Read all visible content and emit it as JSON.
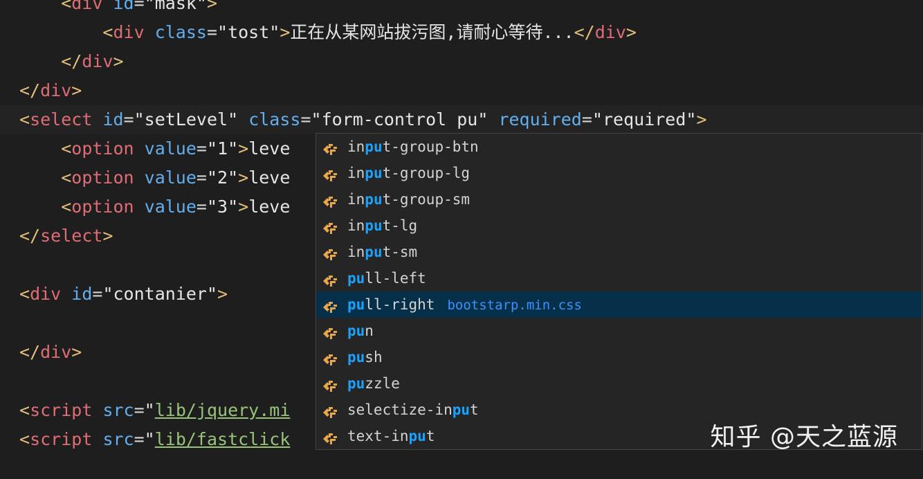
{
  "editor": {
    "lines": [
      {
        "indent": "    ",
        "parts": [
          [
            "ang",
            "<"
          ],
          [
            "tag",
            "div"
          ],
          [
            "plain",
            " "
          ],
          [
            "attr",
            "id"
          ],
          [
            "eq",
            "="
          ],
          [
            "str",
            "\"mask\""
          ],
          [
            "ang",
            ">"
          ]
        ]
      },
      {
        "indent": "        ",
        "parts": [
          [
            "ang",
            "<"
          ],
          [
            "tag",
            "div"
          ],
          [
            "plain",
            " "
          ],
          [
            "attr",
            "class"
          ],
          [
            "eq",
            "="
          ],
          [
            "str",
            "\"tost\""
          ],
          [
            "ang",
            ">"
          ],
          [
            "plain",
            "正在从某网站拔污图,请耐心等待..."
          ],
          [
            "ang",
            "</"
          ],
          [
            "tag",
            "div"
          ],
          [
            "ang",
            ">"
          ]
        ]
      },
      {
        "indent": "    ",
        "parts": [
          [
            "ang",
            "</"
          ],
          [
            "tag",
            "div"
          ],
          [
            "ang",
            ">"
          ]
        ]
      },
      {
        "indent": "",
        "parts": [
          [
            "ang",
            "</"
          ],
          [
            "tag",
            "div"
          ],
          [
            "ang",
            ">"
          ]
        ]
      },
      {
        "indent": "",
        "active": true,
        "parts": [
          [
            "ang",
            "<"
          ],
          [
            "tag",
            "select"
          ],
          [
            "plain",
            " "
          ],
          [
            "attr",
            "id"
          ],
          [
            "eq",
            "="
          ],
          [
            "str",
            "\"setLevel\""
          ],
          [
            "plain",
            " "
          ],
          [
            "attr",
            "class"
          ],
          [
            "eq",
            "="
          ],
          [
            "str",
            "\"form-control pu\""
          ],
          [
            "plain",
            " "
          ],
          [
            "attr",
            "required"
          ],
          [
            "eq",
            "="
          ],
          [
            "str",
            "\"required\""
          ],
          [
            "ang",
            ">"
          ]
        ]
      },
      {
        "indent": "    ",
        "parts": [
          [
            "ang",
            "<"
          ],
          [
            "tag",
            "option"
          ],
          [
            "plain",
            " "
          ],
          [
            "attr",
            "value"
          ],
          [
            "eq",
            "="
          ],
          [
            "str",
            "\"1\""
          ],
          [
            "ang",
            ">"
          ],
          [
            "plain",
            "leve"
          ]
        ]
      },
      {
        "indent": "    ",
        "parts": [
          [
            "ang",
            "<"
          ],
          [
            "tag",
            "option"
          ],
          [
            "plain",
            " "
          ],
          [
            "attr",
            "value"
          ],
          [
            "eq",
            "="
          ],
          [
            "str",
            "\"2\""
          ],
          [
            "ang",
            ">"
          ],
          [
            "plain",
            "leve"
          ]
        ]
      },
      {
        "indent": "    ",
        "parts": [
          [
            "ang",
            "<"
          ],
          [
            "tag",
            "option"
          ],
          [
            "plain",
            " "
          ],
          [
            "attr",
            "value"
          ],
          [
            "eq",
            "="
          ],
          [
            "str",
            "\"3\""
          ],
          [
            "ang",
            ">"
          ],
          [
            "plain",
            "leve"
          ]
        ]
      },
      {
        "indent": "",
        "parts": [
          [
            "ang",
            "</"
          ],
          [
            "tag",
            "select"
          ],
          [
            "ang",
            ">"
          ]
        ]
      },
      {
        "indent": "",
        "parts": []
      },
      {
        "indent": "",
        "parts": [
          [
            "ang",
            "<"
          ],
          [
            "tag",
            "div"
          ],
          [
            "plain",
            " "
          ],
          [
            "attr",
            "id"
          ],
          [
            "eq",
            "="
          ],
          [
            "str",
            "\"contanier\""
          ],
          [
            "ang",
            ">"
          ]
        ]
      },
      {
        "indent": "",
        "parts": []
      },
      {
        "indent": "",
        "parts": [
          [
            "ang",
            "</"
          ],
          [
            "tag",
            "div"
          ],
          [
            "ang",
            ">"
          ]
        ]
      },
      {
        "indent": "",
        "parts": []
      },
      {
        "indent": "",
        "parts": [
          [
            "ang",
            "<"
          ],
          [
            "tag",
            "script"
          ],
          [
            "plain",
            " "
          ],
          [
            "attr",
            "src"
          ],
          [
            "eq",
            "="
          ],
          [
            "str",
            "\""
          ],
          [
            "link",
            "lib/jquery.mi"
          ]
        ]
      },
      {
        "indent": "",
        "parts": [
          [
            "ang",
            "<"
          ],
          [
            "tag",
            "script"
          ],
          [
            "plain",
            " "
          ],
          [
            "attr",
            "src"
          ],
          [
            "eq",
            "="
          ],
          [
            "str",
            "\""
          ],
          [
            "link",
            "lib/fastclick"
          ]
        ]
      }
    ]
  },
  "suggestions": [
    {
      "pre": "in",
      "hl": "pu",
      "post": "t-group-btn"
    },
    {
      "pre": "in",
      "hl": "pu",
      "post": "t-group-lg"
    },
    {
      "pre": "in",
      "hl": "pu",
      "post": "t-group-sm"
    },
    {
      "pre": "in",
      "hl": "pu",
      "post": "t-lg"
    },
    {
      "pre": "in",
      "hl": "pu",
      "post": "t-sm"
    },
    {
      "pre": "",
      "hl": "pu",
      "post": "ll-left"
    },
    {
      "pre": "",
      "hl": "pu",
      "post": "ll-right",
      "detail": "bootstarp.min.css",
      "selected": true
    },
    {
      "pre": "",
      "hl": "pu",
      "post": "n"
    },
    {
      "pre": "",
      "hl": "pu",
      "post": "sh"
    },
    {
      "pre": "",
      "hl": "pu",
      "post": "zzle"
    },
    {
      "pre": "selectize-in",
      "hl": "pu",
      "post": "t"
    },
    {
      "pre": "text-in",
      "hl": "pu",
      "post": "t"
    }
  ],
  "icon": {
    "name": "css-class-icon",
    "color": "#e8a84a"
  },
  "watermark": "知乎 @天之蓝源"
}
